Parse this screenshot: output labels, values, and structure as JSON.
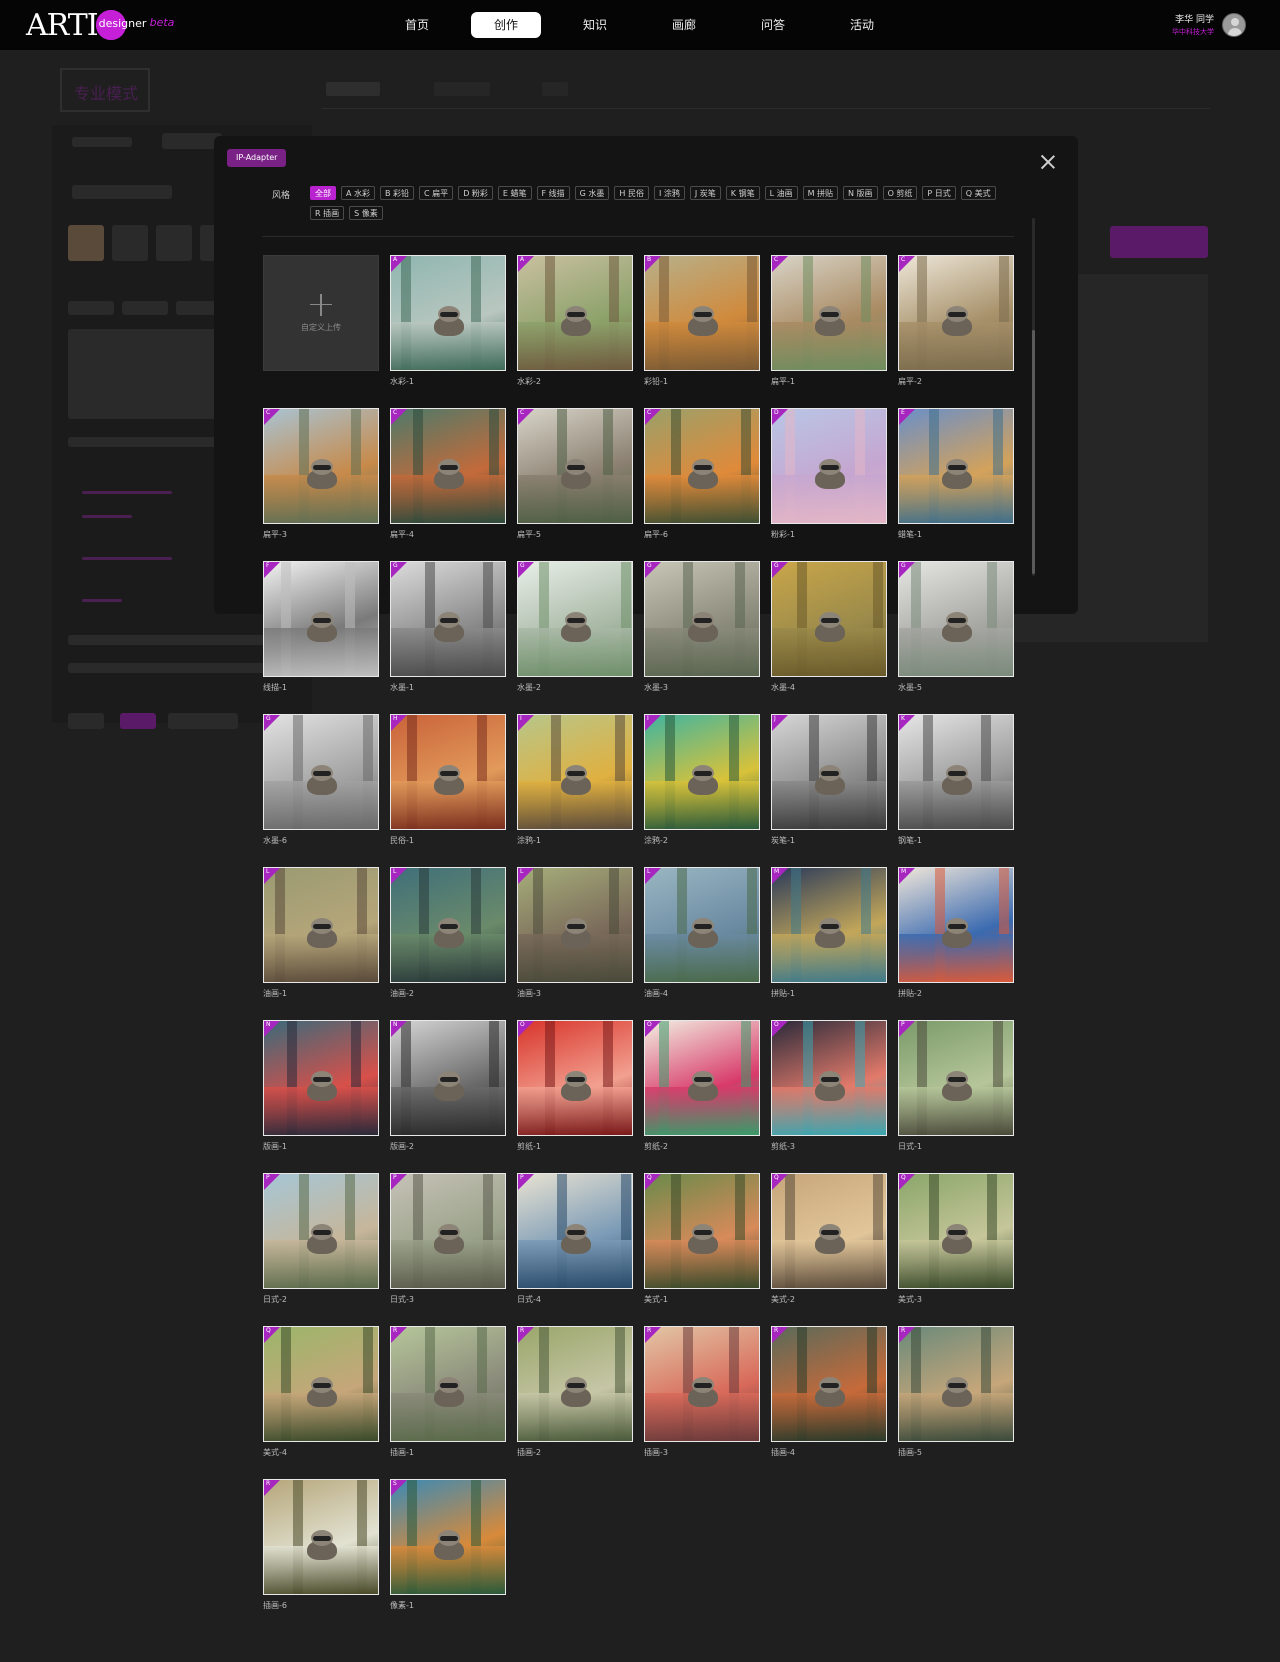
{
  "app": {
    "logo_text": "ARTI",
    "logo_sub": "designer",
    "logo_beta": "beta"
  },
  "nav": {
    "items": [
      "首页",
      "创作",
      "知识",
      "画廊",
      "问答",
      "活动"
    ],
    "active": "创作"
  },
  "user": {
    "name": "李华 同学",
    "school": "华中科技大学"
  },
  "background": {
    "mode_title": "专业模式"
  },
  "modal": {
    "badge": "IP-Adapter",
    "style_label": "风格",
    "filters": [
      "全部",
      "A 水彩",
      "B 彩铅",
      "C 扁平",
      "D 粉彩",
      "E 蜡笔",
      "F 线描",
      "G 水墨",
      "H 民俗",
      "I 涂鸦",
      "J 炭笔",
      "K 钢笔",
      "L 油画",
      "M 拼贴",
      "N 版画",
      "O 剪纸",
      "P 日式",
      "Q 美式",
      "R 插画",
      "S 像素"
    ],
    "active_filter": "全部",
    "upload_label": "自定义上传"
  },
  "styles": [
    {
      "letter": "A",
      "label": "水彩-1",
      "colors": [
        "#8fb6b0",
        "#3f6b59",
        "#b9c7c0"
      ]
    },
    {
      "letter": "A",
      "label": "水彩-2",
      "colors": [
        "#c9c0a0",
        "#6e5a3e",
        "#8da26b"
      ]
    },
    {
      "letter": "B",
      "label": "彩铅-1",
      "colors": [
        "#b7b08a",
        "#7a5a34",
        "#d08a3c"
      ]
    },
    {
      "letter": "C",
      "label": "扁平-1",
      "colors": [
        "#d8d3c6",
        "#6f8d5e",
        "#a98a62"
      ]
    },
    {
      "letter": "C",
      "label": "扁平-2",
      "colors": [
        "#ede6d8",
        "#7c6c4d",
        "#a7916a"
      ]
    },
    {
      "letter": "C",
      "label": "扁平-3",
      "colors": [
        "#a9c3d2",
        "#5f6f54",
        "#c78a4a"
      ]
    },
    {
      "letter": "C",
      "label": "扁平-4",
      "colors": [
        "#4d7a6a",
        "#2e4a3c",
        "#c46a3a"
      ]
    },
    {
      "letter": "C",
      "label": "扁平-5",
      "colors": [
        "#d7d4c8",
        "#4f5f45",
        "#8a7f70"
      ]
    },
    {
      "letter": "C",
      "label": "扁平-6",
      "colors": [
        "#9aa06a",
        "#3f4f32",
        "#e08a3a"
      ]
    },
    {
      "letter": "D",
      "label": "粉彩-1",
      "colors": [
        "#b9c6e6",
        "#e3b6c6",
        "#c5a6d0"
      ]
    },
    {
      "letter": "E",
      "label": "蜡笔-1",
      "colors": [
        "#6a8fc9",
        "#3f6f8a",
        "#d4a25a"
      ]
    },
    {
      "letter": "F",
      "label": "线描-1",
      "colors": [
        "#f2f2f2",
        "#bdbdbd",
        "#7a7a7a"
      ]
    },
    {
      "letter": "G",
      "label": "水墨-1",
      "colors": [
        "#dcdcdc",
        "#4a4a4a",
        "#8a8a8a"
      ]
    },
    {
      "letter": "G",
      "label": "水墨-2",
      "colors": [
        "#e8efe8",
        "#6f8f6a",
        "#a9b9a6"
      ]
    },
    {
      "letter": "G",
      "label": "水墨-3",
      "colors": [
        "#c8c6b6",
        "#5a6650",
        "#8a8a7a"
      ]
    },
    {
      "letter": "G",
      "label": "水墨-4",
      "colors": [
        "#c9a64a",
        "#6a5a2a",
        "#9a8a4a"
      ]
    },
    {
      "letter": "G",
      "label": "水墨-5",
      "colors": [
        "#e6e6e2",
        "#7a8a7a",
        "#a6a6a2"
      ]
    },
    {
      "letter": "G",
      "label": "水墨-6",
      "colors": [
        "#e2e2e2",
        "#6a6a6a",
        "#a2a2a2"
      ]
    },
    {
      "letter": "H",
      "label": "民俗-1",
      "colors": [
        "#c9623a",
        "#7a2e1e",
        "#e29a5a"
      ]
    },
    {
      "letter": "I",
      "label": "涂鸦-1",
      "colors": [
        "#b7c68a",
        "#5a4a3a",
        "#e0b040"
      ]
    },
    {
      "letter": "I",
      "label": "涂鸦-2",
      "colors": [
        "#3fb4a0",
        "#2a5a3a",
        "#d8c23a"
      ]
    },
    {
      "letter": "J",
      "label": "炭笔-1",
      "colors": [
        "#d6d6d6",
        "#3a3a3a",
        "#8a8a8a"
      ]
    },
    {
      "letter": "K",
      "label": "钢笔-1",
      "colors": [
        "#e6e6e6",
        "#4a4a4a",
        "#9a9a9a"
      ]
    },
    {
      "letter": "L",
      "label": "油画-1",
      "colors": [
        "#9a9a72",
        "#5a4a3a",
        "#b6a67a"
      ]
    },
    {
      "letter": "L",
      "label": "油画-2",
      "colors": [
        "#3f6f7a",
        "#2a3a3a",
        "#6a8a6a"
      ]
    },
    {
      "letter": "L",
      "label": "油画-3",
      "colors": [
        "#a6ae7a",
        "#4a4a3a",
        "#7a6a5a"
      ]
    },
    {
      "letter": "L",
      "label": "油画-4",
      "colors": [
        "#9ab6c2",
        "#4a6a4a",
        "#6a8aa2"
      ]
    },
    {
      "letter": "M",
      "label": "拼贴-1",
      "colors": [
        "#2a3a5a",
        "#3f7a8a",
        "#c2a65a"
      ]
    },
    {
      "letter": "M",
      "label": "拼贴-2",
      "colors": [
        "#f0e6da",
        "#d85a3a",
        "#3a6ab0"
      ]
    },
    {
      "letter": "N",
      "label": "版画-1",
      "colors": [
        "#3a6a7a",
        "#2a2a3a",
        "#d8504a"
      ]
    },
    {
      "letter": "N",
      "label": "版画-2",
      "colors": [
        "#d6d6d6",
        "#2a2a2a",
        "#6a6a6a"
      ]
    },
    {
      "letter": "O",
      "label": "剪纸-1",
      "colors": [
        "#d8342a",
        "#7a1a1a",
        "#f2a090"
      ]
    },
    {
      "letter": "O",
      "label": "剪纸-2",
      "colors": [
        "#f2efe2",
        "#3a9a6a",
        "#d83a6a"
      ]
    },
    {
      "letter": "O",
      "label": "剪纸-3",
      "colors": [
        "#2a2a3a",
        "#3aa6b0",
        "#e27a6a"
      ]
    },
    {
      "letter": "P",
      "label": "日式-1",
      "colors": [
        "#7a9a6a",
        "#4a4a3a",
        "#b6c69a"
      ]
    },
    {
      "letter": "P",
      "label": "日式-2",
      "colors": [
        "#a6c6d6",
        "#5a6a4a",
        "#c6b69a"
      ]
    },
    {
      "letter": "P",
      "label": "日式-3",
      "colors": [
        "#c6c2b6",
        "#5a5a4a",
        "#9aa28a"
      ]
    },
    {
      "letter": "P",
      "label": "日式-4",
      "colors": [
        "#e8e2d2",
        "#2a4a6a",
        "#7a9ab6"
      ]
    },
    {
      "letter": "Q",
      "label": "美式-1",
      "colors": [
        "#6a8a4a",
        "#3a4a2a",
        "#d88a5a"
      ]
    },
    {
      "letter": "Q",
      "label": "美式-2",
      "colors": [
        "#c6a67a",
        "#5a4a3a",
        "#e2c69a"
      ]
    },
    {
      "letter": "Q",
      "label": "美式-3",
      "colors": [
        "#8aa66a",
        "#3a4a2a",
        "#c6c69a"
      ]
    },
    {
      "letter": "Q",
      "label": "美式-4",
      "colors": [
        "#9ab66a",
        "#3a4a2a",
        "#c6a67a"
      ]
    },
    {
      "letter": "R",
      "label": "插画-1",
      "colors": [
        "#b6c69a",
        "#5a6a4a",
        "#8a8a7a"
      ]
    },
    {
      "letter": "R",
      "label": "插画-2",
      "colors": [
        "#9aa66a",
        "#4a5a3a",
        "#c6c6a6"
      ]
    },
    {
      "letter": "R",
      "label": "插画-3",
      "colors": [
        "#e2c6a6",
        "#6a3a3a",
        "#d86a5a"
      ]
    },
    {
      "letter": "R",
      "label": "插画-4",
      "colors": [
        "#5a6a5a",
        "#2a3a2a",
        "#c66a3a"
      ]
    },
    {
      "letter": "R",
      "label": "插画-5",
      "colors": [
        "#6a8a7a",
        "#3a4a3a",
        "#c6a67a"
      ]
    },
    {
      "letter": "R",
      "label": "插画-6",
      "colors": [
        "#b6a67a",
        "#4a4a2a",
        "#e2e2d2"
      ]
    },
    {
      "letter": "S",
      "label": "像素-1",
      "colors": [
        "#3a8ab6",
        "#2a5a3a",
        "#d88a3a"
      ]
    }
  ]
}
